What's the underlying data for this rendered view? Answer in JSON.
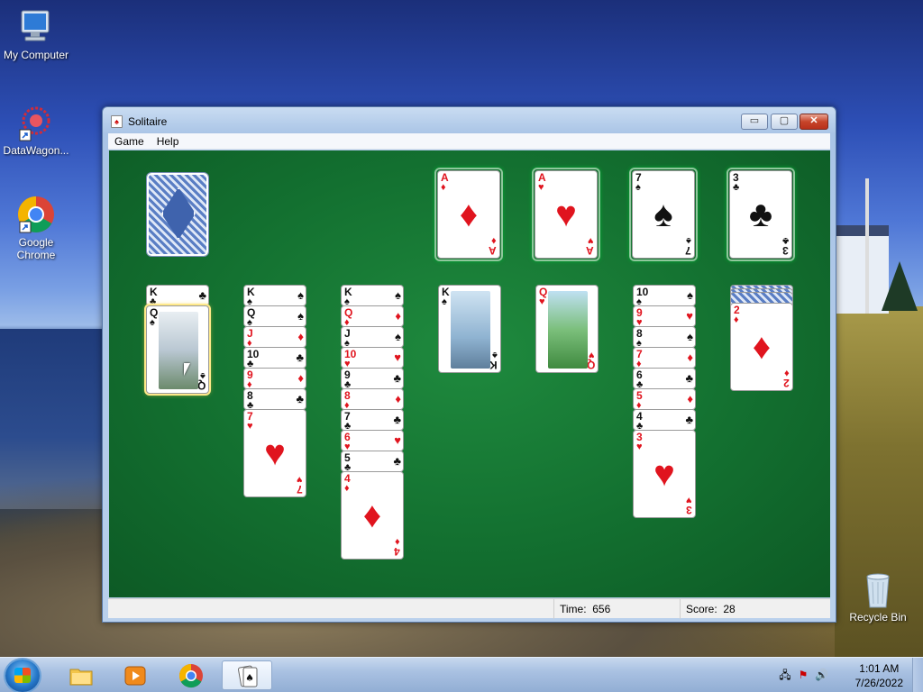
{
  "desktop": {
    "icons": [
      {
        "label": "My Computer"
      },
      {
        "label": "DataWagon..."
      },
      {
        "label": "Google Chrome"
      },
      {
        "label": "Recycle Bin"
      }
    ]
  },
  "window": {
    "title": "Solitaire",
    "menu": [
      "Game",
      "Help"
    ],
    "controls": {
      "minimize": "▭",
      "maximize": "▢",
      "close": "✕"
    }
  },
  "game": {
    "foundations": [
      {
        "rank": "A",
        "suit": "♦",
        "color": "red"
      },
      {
        "rank": "A",
        "suit": "♥",
        "color": "red"
      },
      {
        "rank": "7",
        "suit": "♠",
        "color": "black"
      },
      {
        "rank": "3",
        "suit": "♣",
        "color": "black"
      }
    ],
    "tableau": [
      {
        "hidden": [],
        "cards": [
          [
            "K",
            "♣",
            "black"
          ],
          [
            "Q",
            "♠",
            "black"
          ]
        ]
      },
      {
        "hidden": [],
        "cards": [
          [
            "K",
            "♠",
            "black"
          ],
          [
            "Q",
            "♠",
            "black"
          ],
          [
            "J",
            "♦",
            "red"
          ],
          [
            "10",
            "♣",
            "black"
          ],
          [
            "9",
            "♦",
            "red"
          ],
          [
            "8",
            "♣",
            "black"
          ],
          [
            "7",
            "♥",
            "red"
          ]
        ]
      },
      {
        "hidden": [],
        "cards": [
          [
            "K",
            "♠",
            "black"
          ],
          [
            "Q",
            "♦",
            "red"
          ],
          [
            "J",
            "♠",
            "black"
          ],
          [
            "10",
            "♥",
            "red"
          ],
          [
            "9",
            "♣",
            "black"
          ],
          [
            "8",
            "♦",
            "red"
          ],
          [
            "7",
            "♣",
            "black"
          ],
          [
            "6",
            "♥",
            "red"
          ],
          [
            "5",
            "♣",
            "black"
          ],
          [
            "4",
            "♦",
            "red"
          ]
        ]
      },
      {
        "hidden": [],
        "cards": [
          [
            "K",
            "♠",
            "black"
          ]
        ]
      },
      {
        "hidden": [],
        "cards": [
          [
            "Q",
            "♥",
            "red"
          ]
        ]
      },
      {
        "hidden": [],
        "cards": [
          [
            "10",
            "♠",
            "black"
          ],
          [
            "9",
            "♥",
            "red"
          ],
          [
            "8",
            "♠",
            "black"
          ],
          [
            "7",
            "♦",
            "red"
          ],
          [
            "6",
            "♣",
            "black"
          ],
          [
            "5",
            "♦",
            "red"
          ],
          [
            "4",
            "♣",
            "black"
          ],
          [
            "3",
            "♥",
            "red"
          ]
        ]
      },
      {
        "hidden": [
          1,
          2,
          3
        ],
        "cards": [
          [
            "2",
            "♦",
            "red"
          ]
        ]
      }
    ]
  },
  "status": {
    "time_label": "Time:",
    "time_value": "656",
    "score_label": "Score:",
    "score_value": "28"
  },
  "taskbar": {
    "clock_time": "1:01 AM",
    "clock_date": "7/26/2022",
    "apps": [
      "file-explorer-icon",
      "media-player-icon",
      "chrome-icon",
      "solitaire-icon"
    ]
  },
  "colors": {
    "felt": "#137030",
    "red_suit": "#e0141e",
    "black_suit": "#111111"
  }
}
